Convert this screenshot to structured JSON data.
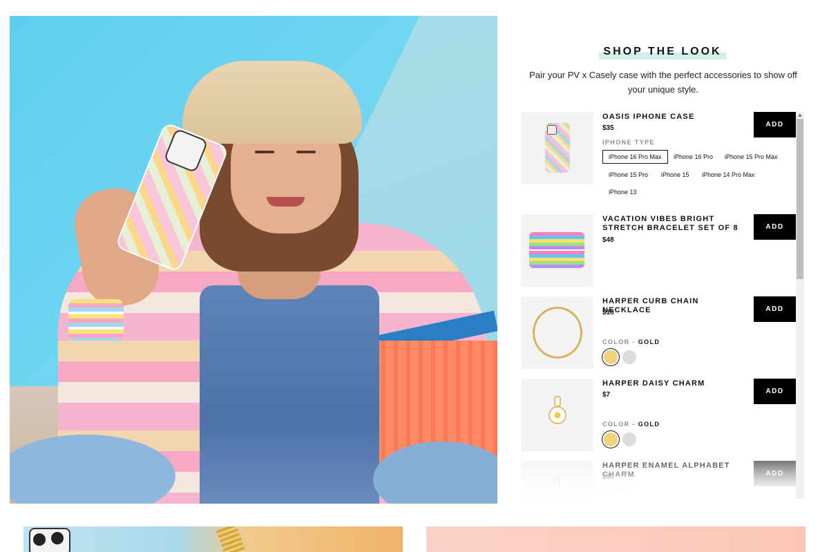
{
  "shop": {
    "title": "SHOP THE LOOK",
    "description": "Pair your PV x Casely case with the perfect accessories to show off your unique style."
  },
  "products": [
    {
      "name": "OASIS IPHONE CASE",
      "price": "$35",
      "add_label": "ADD",
      "option_label": "IPHONE TYPE",
      "options": [
        "iPhone 16 Pro Max",
        "iPhone 16 Pro",
        "iPhone 15 Pro Max",
        "iPhone 15 Pro",
        "iPhone 15",
        "iPhone 14 Pro Max",
        "iPhone 13"
      ],
      "selected_option": "iPhone 16 Pro Max"
    },
    {
      "name": "VACATION VIBES BRIGHT STRETCH BRACELET SET OF 8",
      "price": "$48",
      "add_label": "ADD"
    },
    {
      "name": "HARPER CURB CHAIN NECKLACE",
      "price": "$18",
      "add_label": "ADD",
      "option_label": "COLOR - ",
      "selected_option": "GOLD",
      "swatches": [
        "gold",
        "silver"
      ]
    },
    {
      "name": "HARPER DAISY CHARM",
      "price": "$7",
      "add_label": "ADD",
      "option_label": "COLOR - ",
      "selected_option": "GOLD",
      "swatches": [
        "gold",
        "silver"
      ]
    },
    {
      "name": "HARPER ENAMEL ALPHABET CHARM",
      "price": "$10",
      "add_label": "ADD",
      "option_label": "LETTER"
    }
  ],
  "colors": {
    "button_bg": "#000000",
    "title_highlight": "#cfeee9",
    "gold_swatch": "#f1d37e",
    "silver_swatch": "#dcdcdc"
  }
}
